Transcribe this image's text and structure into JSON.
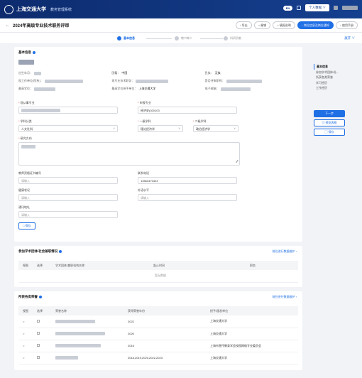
{
  "topbar": {
    "logo_text": "上海交通大学",
    "system_name": "教务管理系统",
    "badge": "EN",
    "personal_center": "个人数据 ∨"
  },
  "subbar": {
    "back": "←",
    "title": "2024年高级专业技术职务评审",
    "actions": [
      "↓ 导出",
      "○ 撤销",
      "○ 填报说明",
      "↓ 岗位信息及岗位通知",
      "↓ 使用手册"
    ]
  },
  "steps": {
    "items": [
      "基本信息",
      "教书育人",
      "科研贡献"
    ],
    "active_index": 0,
    "expand": "展开 ∨"
  },
  "basic_info": {
    "title": "基本信息",
    "fields": [
      {
        "label": "出生年月：",
        "value": ""
      },
      {
        "label": "国籍：",
        "value": "中国"
      },
      {
        "label": "民族：",
        "value": "汉族"
      },
      {
        "label": "现工作单位(院系)：",
        "value": ""
      },
      {
        "label": "现专业技术职务：",
        "value": ""
      },
      {
        "label": "是否评审职称：",
        "value": ""
      },
      {
        "label": "最高学位：",
        "value": ""
      },
      {
        "label": "最高学位授予单位：",
        "value": "上海交通大学"
      },
      {
        "label": "电子邮箱：",
        "value": ""
      }
    ]
  },
  "form": {
    "field1_label": "现从事专业",
    "field2_label": "申报专业",
    "field2_value": "经济史(020103",
    "field3_label": "学科分类",
    "field3_value": "人文社科",
    "field4_label": "一级学科",
    "field4_value": "理论经济学",
    "field5_label": "二级学科",
    "field5_value": "政治经济学",
    "field6_label": "研究方向",
    "field7_label": "教师资格证书编号",
    "field7_placeholder": "请输入",
    "field8_label": "联系电话",
    "field8_value": "13564470423",
    "field9_label": "健康状况",
    "field9_placeholder": "请输入",
    "field10_label": "外语水平",
    "field10_placeholder": "请输入",
    "field11_label": "通讯地址",
    "field11_placeholder": "请输入",
    "save": "□ 保存"
  },
  "academic": {
    "title": "参加学术团体/社会兼职情况",
    "link": "前往进行数据维护 ›",
    "headers": [
      "视图",
      "选择",
      "学术团体/兼职机构名称",
      "起止时间",
      "职务"
    ],
    "empty": "暂无数据"
  },
  "honors": {
    "title": "所获各类荣誉",
    "link": "前往进行数据维护 ›",
    "headers": [
      "视图",
      "选择",
      "荣誉名称",
      "获得荣誉年份",
      "授予/颁发单位"
    ],
    "rows": [
      {
        "name": "",
        "year": "2022",
        "org": "上海交通大学"
      },
      {
        "name": "",
        "year": "2020",
        "org": "上海交通大学"
      },
      {
        "name": "",
        "year": "2016",
        "org": "上海市宣传教育学会校园网络专业委员会"
      },
      {
        "name": "",
        "year": "2018,2019,2020,2022,2023",
        "org": "上海交通大学"
      }
    ]
  },
  "right_nav": {
    "items": [
      "基本信息",
      "参加学术团体/社...",
      "所获各类荣誉",
      "学习经历",
      "工作经历"
    ],
    "next": "下一步",
    "preview": "▤ 预览表格",
    "save": "▢ 保存"
  }
}
